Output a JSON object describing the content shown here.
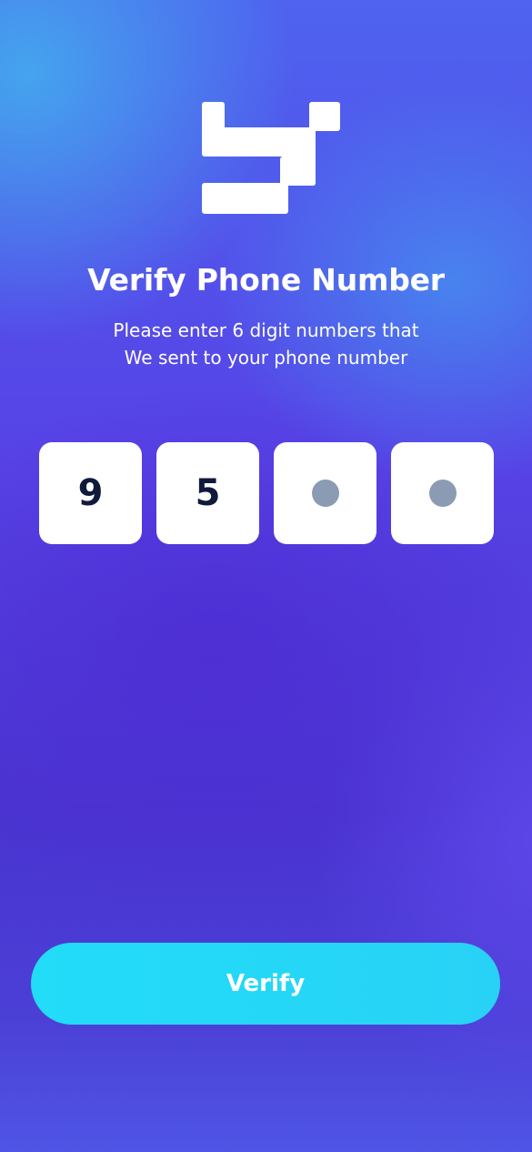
{
  "logo": {
    "icon": "app-logo-icon",
    "color": "#ffffff"
  },
  "header": {
    "title": "Verify Phone Number",
    "subtitle_line1": "Please enter 6 digit numbers that",
    "subtitle_line2": "We sent to your phone number"
  },
  "otp": {
    "boxes": [
      {
        "value": "9",
        "filled": true
      },
      {
        "value": "5",
        "filled": true
      },
      {
        "value": "",
        "filled": false
      },
      {
        "value": "",
        "filled": false
      }
    ],
    "placeholder_dot_color": "#8a9bb3"
  },
  "verify_button": {
    "label": "Verify",
    "color": "#25d8f7"
  },
  "colors": {
    "background_top": "#4aa4ee",
    "background_mid": "#5742e6",
    "text": "#ffffff",
    "digit": "#101a3a"
  }
}
